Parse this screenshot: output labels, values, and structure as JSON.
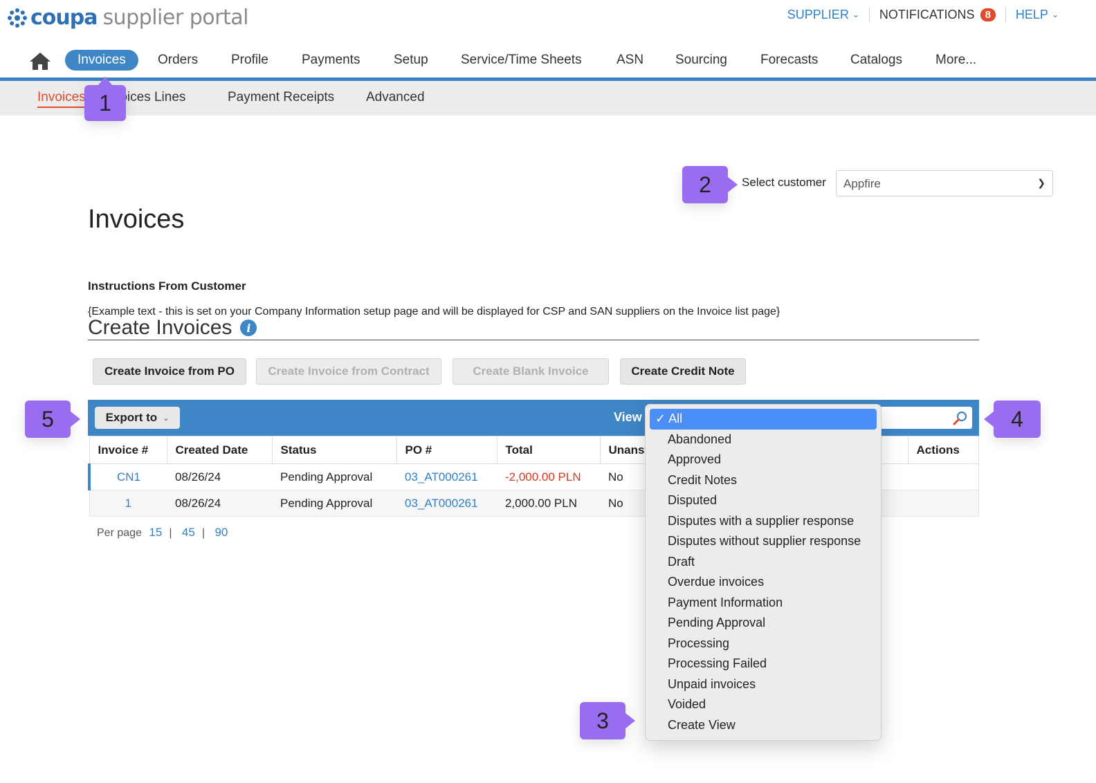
{
  "header": {
    "logo_brand": "coupa",
    "logo_suffix": "supplier portal",
    "supplier": "SUPPLIER",
    "notifications": "NOTIFICATIONS",
    "notifications_count": "8",
    "help": "HELP"
  },
  "mainnav": {
    "items": [
      "Invoices",
      "Orders",
      "Profile",
      "Payments",
      "Setup",
      "Service/Time Sheets",
      "ASN",
      "Sourcing",
      "Forecasts",
      "Catalogs",
      "More..."
    ]
  },
  "subnav": {
    "items": [
      "Invoices",
      "Invoices Lines",
      "Payment Receipts",
      "Advanced"
    ]
  },
  "callouts": [
    "1",
    "2",
    "3",
    "4",
    "5"
  ],
  "customer": {
    "label": "Select customer",
    "value": "Appfire"
  },
  "page": {
    "title": "Invoices",
    "instructions_heading": "Instructions From Customer",
    "instructions_text": "{Example text - this is set on your Company Information setup page and will be displayed for CSP and SAN suppliers on the Invoice list page}",
    "create_heading": "Create Invoices"
  },
  "buttons": {
    "from_po": "Create Invoice from PO",
    "from_contract": "Create Invoice from Contract",
    "blank": "Create Blank Invoice",
    "credit_note": "Create Credit Note"
  },
  "toolbar": {
    "export": "Export to",
    "view": "View"
  },
  "table": {
    "headers": [
      "Invoice #",
      "Created Date",
      "Status",
      "PO #",
      "Total",
      "Unansw",
      "Actions"
    ],
    "rows": [
      {
        "invoice": "CN1",
        "date": "08/26/24",
        "status": "Pending Approval",
        "po": "03_AT000261",
        "total": "-2,000.00 PLN",
        "unanswered": "No"
      },
      {
        "invoice": "1",
        "date": "08/26/24",
        "status": "Pending Approval",
        "po": "03_AT000261",
        "total": "2,000.00 PLN",
        "unanswered": "No"
      }
    ]
  },
  "perpage": {
    "label": "Per page",
    "options": [
      "15",
      "45",
      "90"
    ]
  },
  "view_dropdown": {
    "selected": "All",
    "options": [
      "All",
      "Abandoned",
      "Approved",
      "Credit Notes",
      "Disputed",
      "Disputes with a supplier response",
      "Disputes without supplier response",
      "Draft",
      "Overdue invoices",
      "Payment Information",
      "Pending Approval",
      "Processing",
      "Processing Failed",
      "Unpaid invoices",
      "Voided",
      "Create View"
    ]
  },
  "colors": {
    "accent": "#3f86c7",
    "callout": "#9a6cf0",
    "negative": "#d9371f",
    "badge": "#e14a2b"
  }
}
